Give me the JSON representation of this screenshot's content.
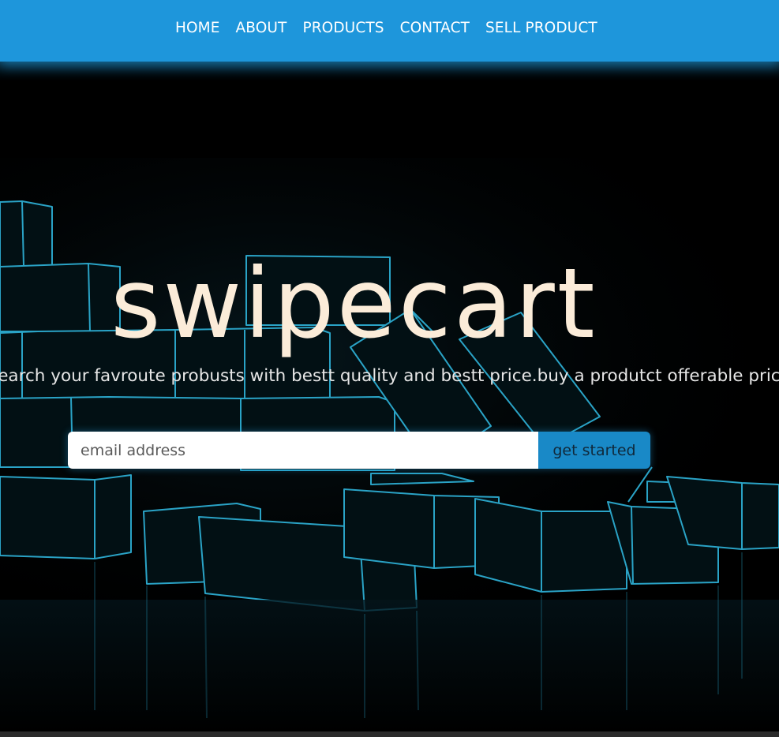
{
  "nav": {
    "items": [
      {
        "label": "HOME"
      },
      {
        "label": "ABOUT"
      },
      {
        "label": "PRODUCTS"
      },
      {
        "label": "CONTACT"
      },
      {
        "label": "SELL PRODUCT"
      }
    ]
  },
  "hero": {
    "title": "swipecart",
    "tagline": "search your favroute probusts with bestt quality and bestt price.buy a produtct offerable price"
  },
  "signup": {
    "placeholder": "email address",
    "button_label": "get started"
  },
  "colors": {
    "navbar": "#1e96db",
    "title": "#fbecd9",
    "button": "#1989c7",
    "box_edge": "#28a6c8"
  }
}
